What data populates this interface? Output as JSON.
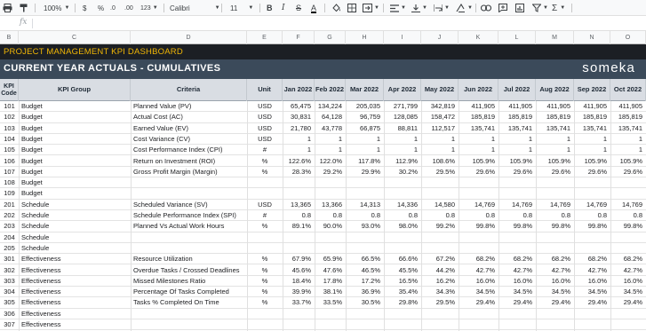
{
  "toolbar": {
    "zoom": "100%",
    "currency": "$",
    "percent": "%",
    "decimals_dec": ".0",
    "decimals_inc": ".00",
    "more_formats": "123",
    "font": "Calibri",
    "font_size": "11",
    "bold": "B",
    "text_color": "A",
    "functions": "Σ"
  },
  "formula_bar": {
    "fx": "fx"
  },
  "column_letters": [
    "B",
    "C",
    "D",
    "E",
    "F",
    "G",
    "H",
    "I",
    "J",
    "K",
    "L",
    "M",
    "N",
    "O"
  ],
  "dashboard": {
    "title": "PROJECT MANAGEMENT KPI DASHBOARD",
    "subtitle": "CURRENT YEAR ACTUALS - CUMULATIVES",
    "brand": "someka"
  },
  "table": {
    "headers": {
      "code": "KPI Code",
      "group": "KPI Group",
      "criteria": "Criteria",
      "unit": "Unit",
      "months": [
        "Jan 2022",
        "Feb 2022",
        "Mar 2022",
        "Apr 2022",
        "May 2022",
        "Jun 2022",
        "Jul 2022",
        "Aug 2022",
        "Sep 2022",
        "Oct 2022"
      ]
    },
    "rows": [
      {
        "code": "101",
        "group": "Budget",
        "criteria": "Planned Value (PV)",
        "unit": "USD",
        "values": [
          "65,475",
          "134,224",
          "205,035",
          "271,799",
          "342,819",
          "411,905",
          "411,905",
          "411,905",
          "411,905",
          "411,905"
        ]
      },
      {
        "code": "102",
        "group": "Budget",
        "criteria": "Actual Cost (AC)",
        "unit": "USD",
        "values": [
          "30,831",
          "64,128",
          "96,759",
          "128,085",
          "158,472",
          "185,819",
          "185,819",
          "185,819",
          "185,819",
          "185,819"
        ]
      },
      {
        "code": "103",
        "group": "Budget",
        "criteria": "Earned Value (EV)",
        "unit": "USD",
        "values": [
          "21,780",
          "43,778",
          "66,875",
          "88,811",
          "112,517",
          "135,741",
          "135,741",
          "135,741",
          "135,741",
          "135,741"
        ]
      },
      {
        "code": "104",
        "group": "Budget",
        "criteria": "Cost Variance (CV)",
        "unit": "USD",
        "values": [
          "1",
          "1",
          "1",
          "1",
          "1",
          "1",
          "1",
          "1",
          "1",
          "1"
        ]
      },
      {
        "code": "105",
        "group": "Budget",
        "criteria": "Cost Performance Index (CPI)",
        "unit": "#",
        "values": [
          "1",
          "1",
          "1",
          "1",
          "1",
          "1",
          "1",
          "1",
          "1",
          "1"
        ]
      },
      {
        "code": "106",
        "group": "Budget",
        "criteria": "Return on Investment (ROI)",
        "unit": "%",
        "values": [
          "122.6%",
          "122.0%",
          "117.8%",
          "112.9%",
          "108.6%",
          "105.9%",
          "105.9%",
          "105.9%",
          "105.9%",
          "105.9%"
        ]
      },
      {
        "code": "107",
        "group": "Budget",
        "criteria": "Gross Profit Margin (Margin)",
        "unit": "%",
        "values": [
          "28.3%",
          "29.2%",
          "29.9%",
          "30.2%",
          "29.5%",
          "29.6%",
          "29.6%",
          "29.6%",
          "29.6%",
          "29.6%"
        ]
      },
      {
        "code": "108",
        "group": "Budget",
        "criteria": "",
        "unit": "",
        "values": [
          "",
          "",
          "",
          "",
          "",
          "",
          "",
          "",
          "",
          ""
        ]
      },
      {
        "code": "109",
        "group": "Budget",
        "criteria": "",
        "unit": "",
        "values": [
          "",
          "",
          "",
          "",
          "",
          "",
          "",
          "",
          "",
          ""
        ]
      },
      {
        "code": "201",
        "group": "Schedule",
        "criteria": "Scheduled Variance (SV)",
        "unit": "USD",
        "values": [
          "13,365",
          "13,366",
          "14,313",
          "14,336",
          "14,580",
          "14,769",
          "14,769",
          "14,769",
          "14,769",
          "14,769"
        ]
      },
      {
        "code": "202",
        "group": "Schedule",
        "criteria": "Schedule Performance Index (SPI)",
        "unit": "#",
        "values": [
          "0.8",
          "0.8",
          "0.8",
          "0.8",
          "0.8",
          "0.8",
          "0.8",
          "0.8",
          "0.8",
          "0.8"
        ]
      },
      {
        "code": "203",
        "group": "Schedule",
        "criteria": "Planned Vs Actual Work Hours",
        "unit": "%",
        "values": [
          "89.1%",
          "90.0%",
          "93.0%",
          "98.0%",
          "99.2%",
          "99.8%",
          "99.8%",
          "99.8%",
          "99.8%",
          "99.8%"
        ]
      },
      {
        "code": "204",
        "group": "Schedule",
        "criteria": "",
        "unit": "",
        "values": [
          "",
          "",
          "",
          "",
          "",
          "",
          "",
          "",
          "",
          ""
        ]
      },
      {
        "code": "205",
        "group": "Schedule",
        "criteria": "",
        "unit": "",
        "values": [
          "",
          "",
          "",
          "",
          "",
          "",
          "",
          "",
          "",
          ""
        ]
      },
      {
        "code": "301",
        "group": "Effectiveness",
        "criteria": "Resource Utilization",
        "unit": "%",
        "values": [
          "67.9%",
          "65.9%",
          "66.5%",
          "66.6%",
          "67.2%",
          "68.2%",
          "68.2%",
          "68.2%",
          "68.2%",
          "68.2%"
        ]
      },
      {
        "code": "302",
        "group": "Effectiveness",
        "criteria": "Overdue Tasks / Crossed Deadlines",
        "unit": "%",
        "values": [
          "45.6%",
          "47.6%",
          "46.5%",
          "45.5%",
          "44.2%",
          "42.7%",
          "42.7%",
          "42.7%",
          "42.7%",
          "42.7%"
        ]
      },
      {
        "code": "303",
        "group": "Effectiveness",
        "criteria": "Missed Milestones Ratio",
        "unit": "%",
        "values": [
          "18.4%",
          "17.8%",
          "17.2%",
          "16.5%",
          "16.2%",
          "16.0%",
          "16.0%",
          "16.0%",
          "16.0%",
          "16.0%"
        ]
      },
      {
        "code": "304",
        "group": "Effectiveness",
        "criteria": "Percentage Of Tasks Completed",
        "unit": "%",
        "values": [
          "39.9%",
          "38.1%",
          "36.9%",
          "35.4%",
          "34.3%",
          "34.5%",
          "34.5%",
          "34.5%",
          "34.5%",
          "34.5%"
        ]
      },
      {
        "code": "305",
        "group": "Effectiveness",
        "criteria": "Tasks % Completed On Time",
        "unit": "%",
        "values": [
          "33.7%",
          "33.5%",
          "30.5%",
          "29.8%",
          "29.5%",
          "29.4%",
          "29.4%",
          "29.4%",
          "29.4%",
          "29.4%"
        ]
      },
      {
        "code": "306",
        "group": "Effectiveness",
        "criteria": "",
        "unit": "",
        "values": [
          "",
          "",
          "",
          "",
          "",
          "",
          "",
          "",
          "",
          ""
        ]
      },
      {
        "code": "307",
        "group": "Effectiveness",
        "criteria": "",
        "unit": "",
        "values": [
          "",
          "",
          "",
          "",
          "",
          "",
          "",
          "",
          "",
          ""
        ]
      }
    ]
  }
}
